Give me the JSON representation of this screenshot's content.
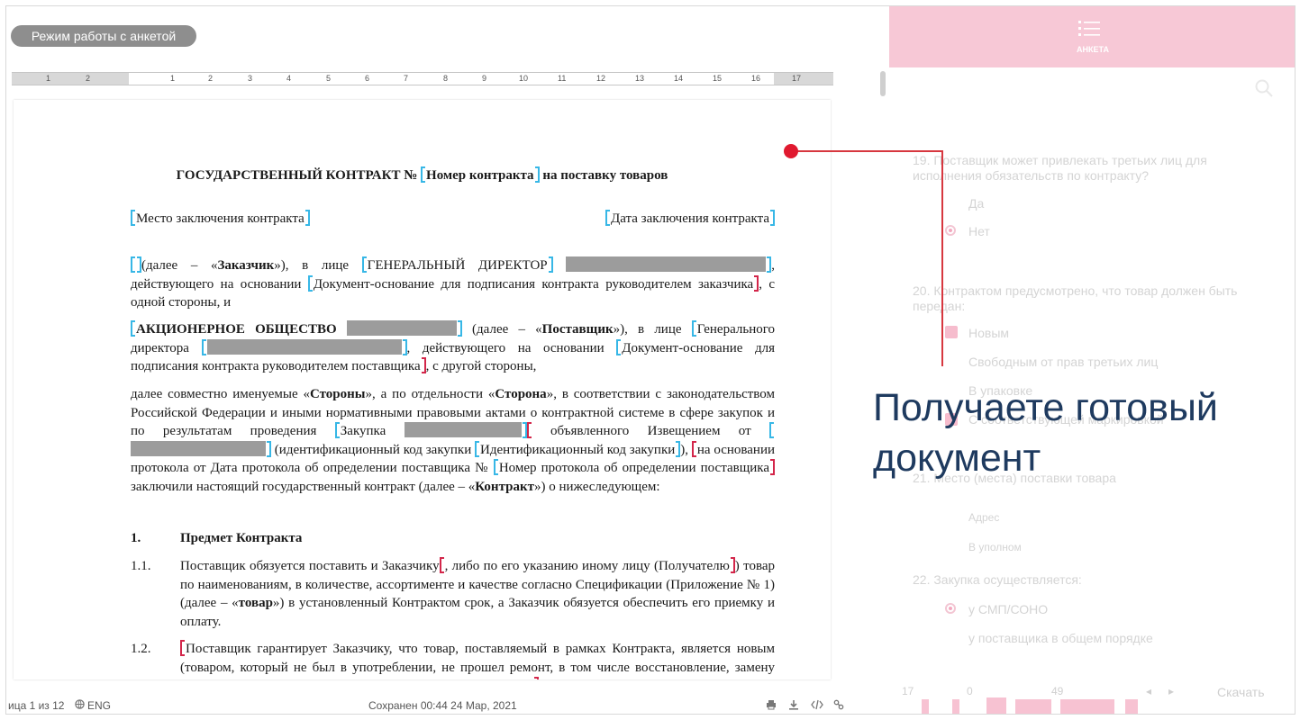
{
  "editor": {
    "mode_button": "Режим работы с анкетой",
    "ruler_labels": [
      "1",
      "2",
      "1",
      "1",
      "2",
      "3",
      "4",
      "5",
      "6",
      "7",
      "8",
      "9",
      "10",
      "11",
      "12",
      "13",
      "14",
      "15",
      "16",
      "17",
      "1"
    ],
    "document": {
      "title_pre": "ГОСУДАРСТВЕННЫЙ КОНТРАКТ № ",
      "title_field": "Номер контракта",
      "title_post": " на поставку товаров",
      "place": "Место заключения контракта",
      "date": "Дата заключения контракта",
      "p1_a": "(далее – «",
      "p1_b": "Заказчик",
      "p1_c": "»), в лице ",
      "p1_d": "ГЕНЕРАЛЬНЫЙ ДИРЕКТОР",
      "p1_e": ", действующего на основании ",
      "p1_f": "Документ-основание для подписания контракта руководителем заказчика",
      "p1_g": ", с одной стороны, и",
      "p2_a": "АКЦИОНЕРНОЕ ОБЩЕСТВО",
      "p2_b": " (далее – «",
      "p2_c": "Поставщик",
      "p2_d": "»), в лице ",
      "p2_e": "Генерального директора",
      "p2_f": ", действующего на основании ",
      "p2_g": "Документ-основание для подписания контракта руководителем поставщика",
      "p2_h": ", с другой стороны,",
      "p3_a": "далее совместно именуемые «",
      "p3_b": "Стороны",
      "p3_c": "», а по отдельности «",
      "p3_d": "Сторона",
      "p3_e": "», в соответствии с законодательством Российской Федерации и иными нормативными правовыми актами о контрактной системе в сфере закупок и по результатам проведения ",
      "p3_f": "Закупка",
      "p3_g": " объявленного Извещением от ",
      "p3_h": " (идентификационный код закупки ",
      "p3_i": "Идентификационный код закупки",
      "p3_j": "), ",
      "p3_k": "на основании протокола от Дата протокола об определении поставщика № ",
      "p3_l": "Номер протокола об определении поставщика",
      "p3_m": " заключили настоящий государственный контракт (далее – «",
      "p3_n": "Контракт",
      "p3_o": "») о нижеследующем:",
      "s1_num": "1.",
      "s1_title": "Предмет Контракта",
      "s11_num": "1.1.",
      "s11_a": "Поставщик обязуется поставить и  Заказчику",
      "s11_b": ", либо по его указанию иному лицу (Получателю",
      "s11_c": ") товар по наименованиям, в количестве, ассортименте и качестве согласно Спецификации (Приложение № 1) (далее – «",
      "s11_d": "товар",
      "s11_e": "») в установленный Контрактом срок, а Заказчик обязуется обеспечить его приемку и оплату.",
      "s12_num": "1.2.",
      "s12_a": "Поставщик гарантирует Заказчику, что товар, поставляемый в рамках Контракта, является новым (товаром, который не был в употреблении, не прошел ремонт, в том числе восстановление, замену составных частей, восстановление потребительских свойств)"
    },
    "status": {
      "page": "ица 1 из 12",
      "lang": "ENG",
      "saved": "Сохранен 00:44 24 Мар, 2021"
    }
  },
  "panel": {
    "header_label": "АНКЕТА",
    "q19": "19. Поставщик может привлекать третьих лиц для исполнения обязательств по контракту?",
    "q19_opt1": "Да",
    "q19_opt2": "Нет",
    "q20": "20. Контрактом предусмотрено, что товар должен быть передан:",
    "q20_opt1": "Новым",
    "q20_opt2": "Свободным от прав третьих лиц",
    "q20_opt3": "В упаковке",
    "q20_opt4": "С соответствующей маркировкой",
    "q21": "21. Место (места) поставки товара",
    "q21_val": "Адрес",
    "q21_val2": "В уполном",
    "q22": "22. Закупка осуществляется:",
    "q22_opt1": "у СМП/СОНО",
    "q22_opt2": "у поставщика в общем порядке",
    "nav_a": "17",
    "nav_b": "0",
    "nav_c": "49",
    "nav_download": "Скачать"
  },
  "overlay": {
    "caption": "Получаете готовый документ"
  },
  "colors": {
    "accent_pink": "#f7c8d6",
    "callout_red": "#e0192f",
    "bracket_cyan": "#37b7e6",
    "bracket_red": "#d3264a",
    "caption_navy": "#1e3a5f"
  }
}
